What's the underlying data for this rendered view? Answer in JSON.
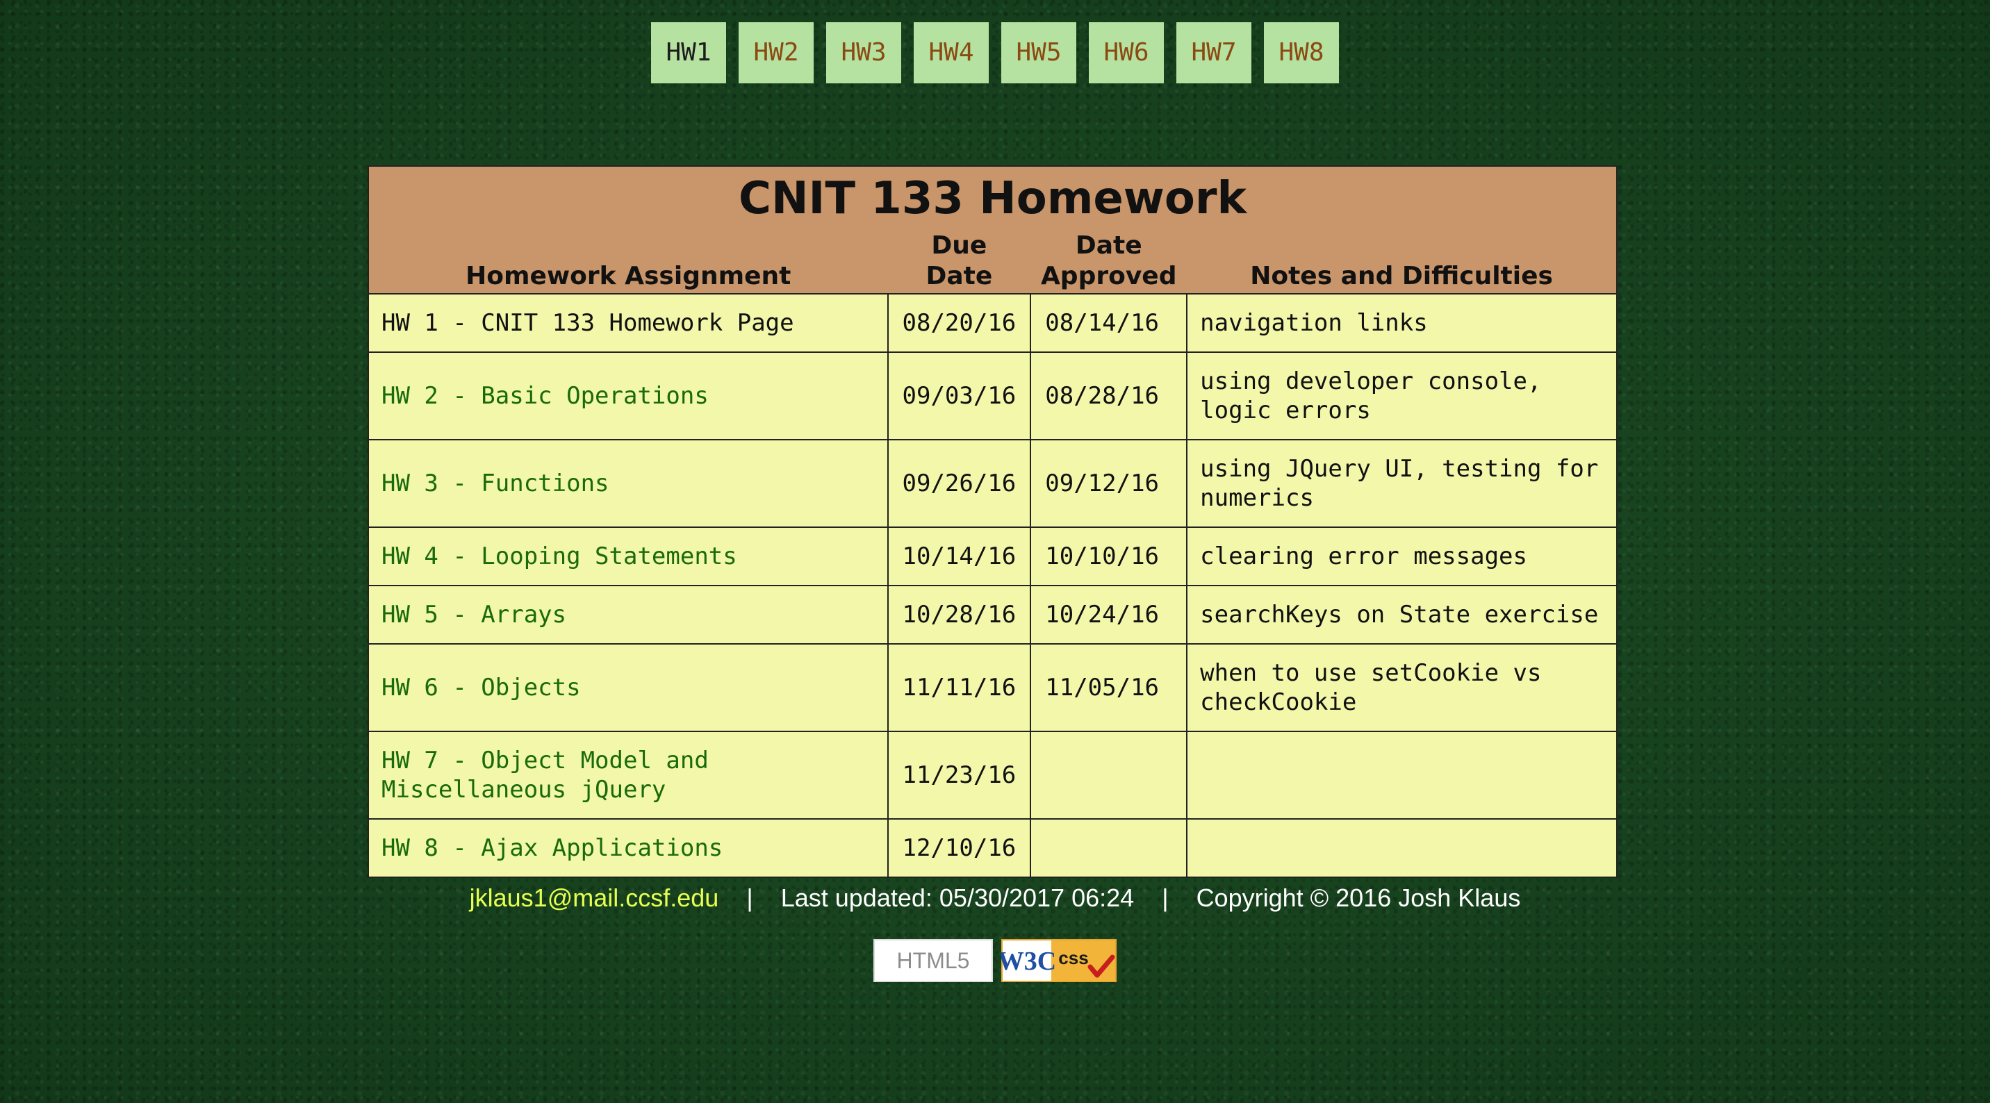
{
  "nav": {
    "items": [
      "HW1",
      "HW2",
      "HW3",
      "HW4",
      "HW5",
      "HW6",
      "HW7",
      "HW8"
    ],
    "active_index": 0
  },
  "table": {
    "title": "CNIT 133 Homework",
    "headers": {
      "assignment": "Homework Assignment",
      "due": "Due Date",
      "approved_line1": "Date",
      "approved_line2": "Approved",
      "notes": "Notes and Difficulties"
    },
    "rows": [
      {
        "assignment": "HW 1 - CNIT 133 Homework Page",
        "due": "08/20/16",
        "approved": "08/14/16",
        "notes": "navigation links"
      },
      {
        "assignment": "HW 2 - Basic Operations",
        "due": "09/03/16",
        "approved": "08/28/16",
        "notes": "using developer console, logic errors"
      },
      {
        "assignment": "HW 3 - Functions",
        "due": "09/26/16",
        "approved": "09/12/16",
        "notes": "using JQuery UI, testing for numerics"
      },
      {
        "assignment": "HW 4 - Looping Statements",
        "due": "10/14/16",
        "approved": "10/10/16",
        "notes": "clearing error messages"
      },
      {
        "assignment": "HW 5 - Arrays",
        "due": "10/28/16",
        "approved": "10/24/16",
        "notes": "searchKeys on State exercise"
      },
      {
        "assignment": "HW 6 - Objects",
        "due": "11/11/16",
        "approved": "11/05/16",
        "notes": "when to use setCookie vs checkCookie"
      },
      {
        "assignment": "HW 7 - Object Model and Miscellaneous jQuery",
        "due": "11/23/16",
        "approved": "",
        "notes": ""
      },
      {
        "assignment": "HW 8 - Ajax Applications",
        "due": "12/10/16",
        "approved": "",
        "notes": ""
      }
    ]
  },
  "footer": {
    "email": "jklaus1@mail.ccsf.edu",
    "separator": "|",
    "updated": "Last updated: 05/30/2017 06:24",
    "copyright": "Copyright © 2016 Josh Klaus"
  },
  "badges": {
    "html5": "HTML5",
    "css_w3c": "W3C",
    "css": "css"
  },
  "colors": {
    "background": "#17411e",
    "nav_bg": "#b5e2a0",
    "nav_text": "#8a4a12",
    "header_bg": "#c9956a",
    "table_bg": "#f2f7a9",
    "link": "#1a6a0c",
    "email": "#e6ff52"
  }
}
